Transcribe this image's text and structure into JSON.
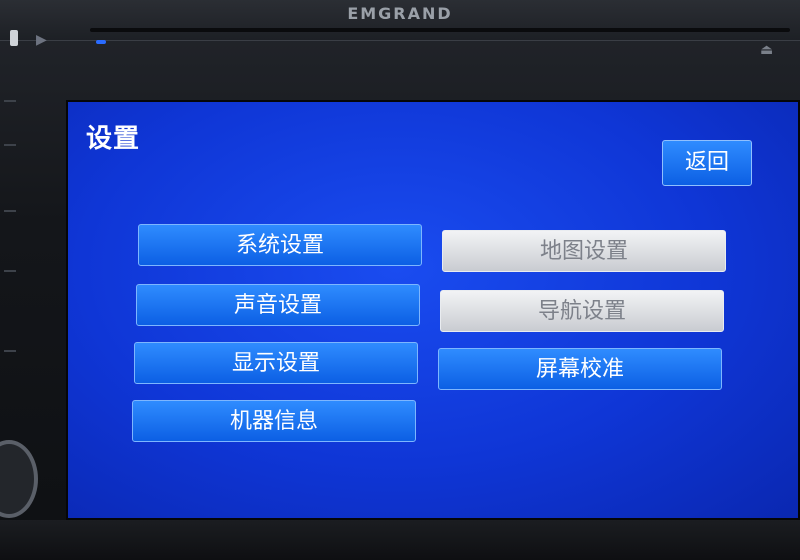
{
  "device": {
    "brand": "EMGRAND",
    "play_icon": "play-icon",
    "eject_icon": "eject-icon"
  },
  "screen": {
    "title": "设置",
    "back_label": "返回"
  },
  "menu": {
    "left": [
      {
        "label": "系统设置"
      },
      {
        "label": "声音设置"
      },
      {
        "label": "显示设置"
      },
      {
        "label": "机器信息"
      }
    ],
    "right": [
      {
        "label": "地图设置",
        "state": "disabled"
      },
      {
        "label": "导航设置",
        "state": "disabled"
      },
      {
        "label": "屏幕校准",
        "state": "active"
      }
    ]
  },
  "colors": {
    "screen_bg": "#0f36d6",
    "button_active": "#1a73f0",
    "button_disabled": "#dcdfe3"
  }
}
